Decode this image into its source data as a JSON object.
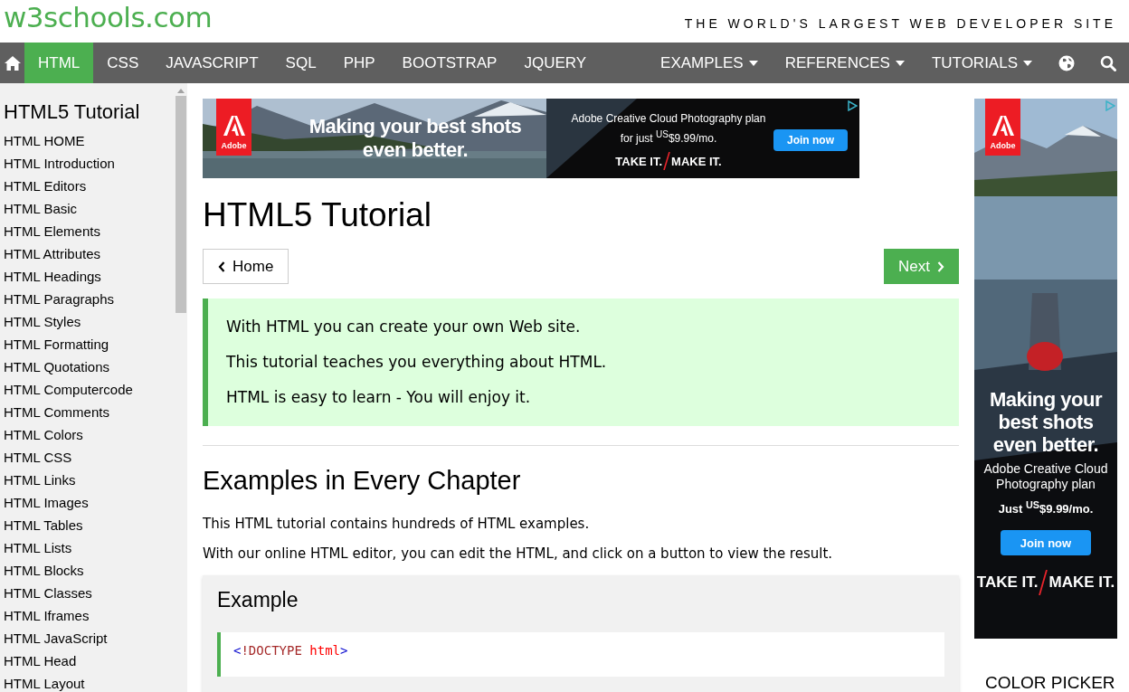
{
  "header": {
    "logo": "w3schools.com",
    "tagline": "THE WORLD'S LARGEST WEB DEVELOPER SITE"
  },
  "nav": {
    "left": [
      {
        "kind": "home",
        "selected": false
      },
      {
        "kind": "link",
        "label": "HTML",
        "selected": true
      },
      {
        "kind": "link",
        "label": "CSS",
        "selected": false
      },
      {
        "kind": "link",
        "label": "JAVASCRIPT",
        "selected": false
      },
      {
        "kind": "link",
        "label": "SQL",
        "selected": false
      },
      {
        "kind": "link",
        "label": "PHP",
        "selected": false
      },
      {
        "kind": "link",
        "label": "BOOTSTRAP",
        "selected": false
      },
      {
        "kind": "link",
        "label": "JQUERY",
        "selected": false
      }
    ],
    "right": [
      {
        "kind": "dropdown",
        "label": "EXAMPLES"
      },
      {
        "kind": "dropdown",
        "label": "REFERENCES"
      },
      {
        "kind": "dropdown",
        "label": "TUTORIALS"
      },
      {
        "kind": "globe"
      },
      {
        "kind": "search"
      }
    ]
  },
  "sidebar": {
    "title": "HTML5 Tutorial",
    "items": [
      "HTML HOME",
      "HTML Introduction",
      "HTML Editors",
      "HTML Basic",
      "HTML Elements",
      "HTML Attributes",
      "HTML Headings",
      "HTML Paragraphs",
      "HTML Styles",
      "HTML Formatting",
      "HTML Quotations",
      "HTML Computercode",
      "HTML Comments",
      "HTML Colors",
      "HTML CSS",
      "HTML Links",
      "HTML Images",
      "HTML Tables",
      "HTML Lists",
      "HTML Blocks",
      "HTML Classes",
      "HTML Iframes",
      "HTML JavaScript",
      "HTML Head",
      "HTML Layout"
    ]
  },
  "banner_ad": {
    "brand": "Adobe",
    "headline": "Making your best shots even better.",
    "offer": "Adobe Creative Cloud Photography plan for just $^{US}$$9.99/mo.",
    "slogan_left": "TAKE IT.",
    "slogan_right": "MAKE IT.",
    "button": "Join now"
  },
  "main": {
    "title": "HTML5 Tutorial",
    "prev_button": "Home",
    "next_button": "Next",
    "note": [
      "With HTML you can create your own Web site.",
      "This tutorial teaches you everything about HTML.",
      "HTML is easy to learn - You will enjoy it."
    ],
    "section_title": "Examples in Every Chapter",
    "paragraphs": [
      "This HTML tutorial contains hundreds of HTML examples.",
      "With our online HTML editor, you can edit the HTML, and click on a button to view the result."
    ],
    "example": {
      "title": "Example",
      "code": [
        {
          "kind": "bracket",
          "text": "<"
        },
        {
          "kind": "tag",
          "text": "!DOCTYPE"
        },
        {
          "kind": "attr",
          "text": " html"
        },
        {
          "kind": "bracket",
          "text": ">"
        }
      ]
    }
  },
  "side_ad": {
    "brand": "Adobe",
    "headline": "Making your best shots even better.",
    "product": "Adobe Creative Cloud Photography plan",
    "price": "Just $^{US}$$9.99/mo.",
    "button": "Join now",
    "slogan_left": "TAKE IT.",
    "slogan_right": "MAKE IT."
  },
  "color_picker": "COLOR PICKER"
}
